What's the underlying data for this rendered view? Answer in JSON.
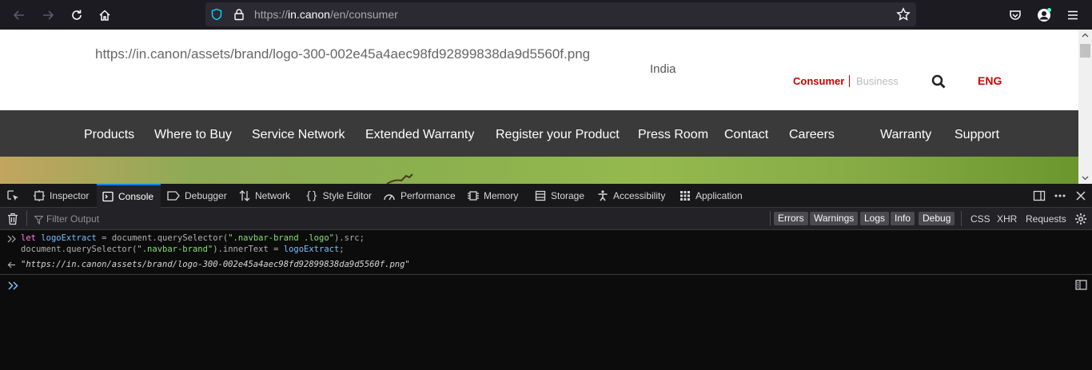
{
  "browser": {
    "url_scheme": "https://",
    "url_host": "in.canon",
    "url_path": "/en/consumer",
    "icons": [
      "back-arrow-icon",
      "forward-arrow-icon",
      "reload-icon",
      "home-icon",
      "shield-icon",
      "lock-icon",
      "bookmark-star-icon",
      "pocket-icon",
      "account-icon",
      "menu-icon"
    ]
  },
  "page": {
    "brand_text": "https://in.canon/assets/brand/logo-300-002e45a4aec98fd92899838da9d5560f.png",
    "region": "India",
    "consumer": "Consumer",
    "business": "Business",
    "lang": "ENG",
    "nav": [
      "Products",
      "Where to Buy",
      "Service Network",
      "Extended Warranty",
      "Register your Product",
      "Press Room",
      "Contact",
      "Careers",
      "Warranty",
      "Support"
    ],
    "colors": {
      "accent": "#cc0000",
      "navbar": "#3a3a3a"
    }
  },
  "devtools": {
    "tabs": [
      "Inspector",
      "Console",
      "Debugger",
      "Network",
      "Style Editor",
      "Performance",
      "Memory",
      "Storage",
      "Accessibility",
      "Application"
    ],
    "selected_tab": "Console",
    "filter_placeholder": "Filter Output",
    "filter_buttons": [
      "Errors",
      "Warnings",
      "Logs",
      "Info",
      "Debug"
    ],
    "filter_plain": [
      "CSS",
      "XHR",
      "Requests"
    ],
    "console": {
      "line1": {
        "kw": "let",
        "var": "logoExtract",
        "op1": " = ",
        "call": "document.querySelector(",
        "str": "\".navbar-brand .logo\"",
        "tail": ").src;"
      },
      "line2": {
        "call": "document.querySelector(",
        "str": "\".navbar-brand\"",
        "mid": ").innerText = ",
        "var": "logoExtract",
        "tail": ";"
      },
      "result": "\"https://in.canon/assets/brand/logo-300-002e45a4aec98fd92899838da9d5560f.png\""
    }
  }
}
